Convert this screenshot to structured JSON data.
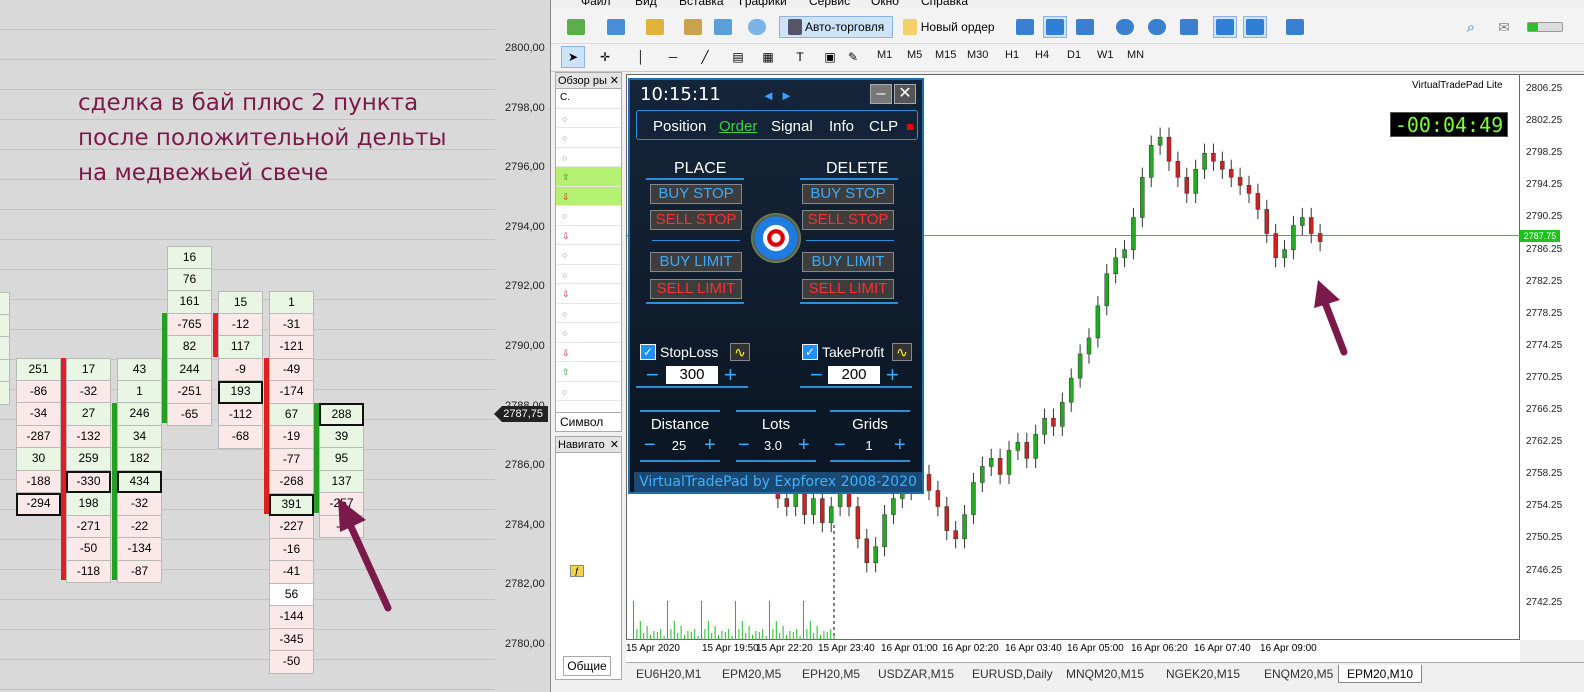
{
  "left_panel": {
    "annotation": "сделка в бай плюс 2 пункта\nпосле положительной дельты\nна медвежьей свече",
    "price_labels": [
      "2800,00",
      "2798,00",
      "2796,00",
      "2794,00",
      "2792,00",
      "2790,00",
      "2788,00",
      "2786,00",
      "2784,00",
      "2782,00",
      "2780,00"
    ],
    "current_price": "2787,75",
    "columns": [
      {
        "cells": [
          "",
          "",
          "",
          "",
          ""
        ],
        "shade": "pos"
      },
      {
        "cells": [
          "251",
          "-86",
          "-34",
          "-287",
          "30",
          "-188",
          "-294"
        ],
        "shade": "mix"
      },
      {
        "cells": [
          "17",
          "-32",
          "27",
          "-132",
          "259",
          "-330",
          "198",
          "-271",
          "-50",
          "-118"
        ],
        "shade": "mix"
      },
      {
        "cells": [
          "43",
          "1",
          "246",
          "34",
          "182",
          "434",
          "-32",
          "-22",
          "-134",
          "-87"
        ],
        "shade": "mix"
      },
      {
        "cells": [
          "16",
          "76",
          "161",
          "-765",
          "82",
          "244",
          "-251",
          "-65"
        ],
        "shade": "mix"
      },
      {
        "cells": [
          "15",
          "-12",
          "117",
          "-9",
          "193",
          "-112",
          "-68"
        ],
        "shade": "mix"
      },
      {
        "cells": [
          "1",
          "-31",
          "-121",
          "-49",
          "-174",
          "67",
          "-19",
          "-77",
          "-268",
          "391",
          "-227",
          "-16",
          "-41",
          "56",
          "-144",
          "-345",
          "-50"
        ],
        "shade": "mix"
      },
      {
        "cells": [
          "288",
          "39",
          "95",
          "137",
          "-257",
          "-3"
        ],
        "shade": "mix"
      }
    ]
  },
  "menu": {
    "items": [
      "Файл",
      "Вид",
      "Вставка",
      "Графики",
      "Сервис",
      "Окно",
      "Справка"
    ]
  },
  "toolbar": {
    "autotrade": "Авто-торговля",
    "new_order": "Новый ордер",
    "timeframes": [
      "M1",
      "M5",
      "M15",
      "M30",
      "H1",
      "H4",
      "D1",
      "W1",
      "MN"
    ]
  },
  "market_watch": {
    "title": "Обзор ры",
    "header": "С.",
    "symbol_tab": "Символ"
  },
  "navigator": {
    "title": "Навигато",
    "tab": "Общие"
  },
  "vtp": {
    "time": "10:15:11",
    "tabs": [
      "Position",
      "Order",
      "Signal",
      "Info",
      "CLP"
    ],
    "place": "PLACE",
    "delete": "DELETE",
    "buy_stop": "BUY STOP",
    "sell_stop": "SELL STOP",
    "buy_limit": "BUY LIMIT",
    "sell_limit": "SELL LIMIT",
    "stoploss_label": "StopLoss",
    "stoploss_value": "300",
    "takeprofit_label": "TakeProfit",
    "takeprofit_value": "200",
    "distance_label": "Distance",
    "distance_value": "25",
    "lots_label": "Lots",
    "lots_value": "3.0",
    "grids_label": "Grids",
    "grids_value": "1",
    "footer": "VirtualTradePad by Expforex 2008-2020"
  },
  "chart": {
    "brand": "VirtualTradePad  Lite",
    "timer": "-00:04:49",
    "current_price": "2787.75",
    "price_labels": [
      "2806.25",
      "2802.25",
      "2798.25",
      "2794.25",
      "2790.25",
      "2786.25",
      "2782.25",
      "2778.25",
      "2774.25",
      "2770.25",
      "2766.25",
      "2762.25",
      "2758.25",
      "2754.25",
      "2750.25",
      "2746.25",
      "2742.25"
    ],
    "time_labels": [
      "15 Apr 2020",
      "15 Apr 19:50",
      "15 Apr 22:20",
      "15 Apr 23:40",
      "16 Apr 01:00",
      "16 Apr 02:20",
      "16 Apr 03:40",
      "16 Apr 05:00",
      "16 Apr 06:20",
      "16 Apr 07:40",
      "16 Apr 09:00"
    ]
  },
  "tabs": [
    "EU6H20,M1",
    "EPM20,M5",
    "EPH20,M5",
    "USDZAR,M15",
    "EURUSD,Daily",
    "MNQM20,M15",
    "NGEK20,M15",
    "ENQM20,M5",
    "EPM20,M10"
  ],
  "colors": {
    "bull": "#22aa22",
    "bear": "#cc2222",
    "accent": "#2a8fd6",
    "arrow": "#7b1a4a"
  }
}
